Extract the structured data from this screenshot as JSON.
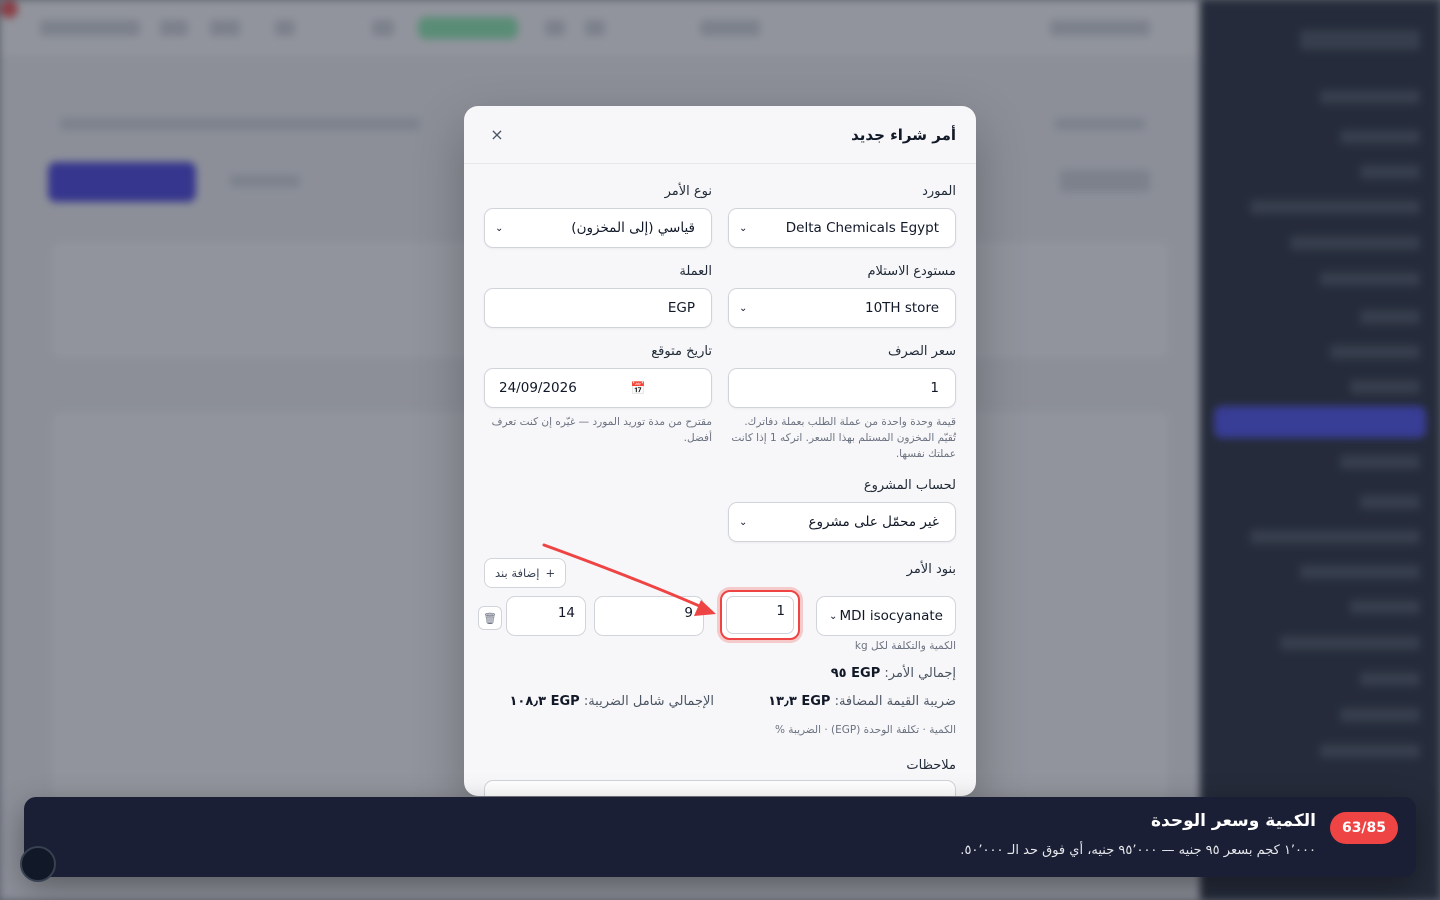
{
  "modal": {
    "title": "أمر شراء جديد",
    "close_icon": "×",
    "supplier": {
      "label": "المورد",
      "value": "Delta Chemicals Egypt"
    },
    "order_type": {
      "label": "نوع الأمر",
      "value": "قياسي (إلى المخزون)"
    },
    "warehouse": {
      "label": "مستودع الاستلام",
      "value": "10TH store"
    },
    "currency": {
      "label": "العملة",
      "value": "EGP"
    },
    "exchange_rate": {
      "label": "سعر الصرف",
      "value": "1",
      "help": "قيمة وحدة واحدة من عملة الطلب بعملة دفاترك. تُقيّم المخزون المستلم بهذا السعر. اتركه 1 إذا كانت عملتك نفسها."
    },
    "expected_date": {
      "label": "تاريخ متوقع",
      "value": "24/09/2026",
      "help": "مقترح من مدة توريد المورد — غيّره إن كنت تعرف أفضل."
    },
    "project": {
      "label": "لحساب المشروع",
      "value": "غير محمّل على مشروع"
    },
    "lines": {
      "label": "بنود الأمر",
      "add_button": "إضافة بند",
      "product": "MDI isocyanate",
      "quantity": "1",
      "unit_cost": "9",
      "tax_percent": "14",
      "hint": "الكمية والتكلفة لكل kg"
    },
    "totals": {
      "order_total_label": "إجمالي الأمر:",
      "order_total_value": "EGP ٩٥",
      "vat_label": "ضريبة القيمة المضافة:",
      "vat_value": "EGP ١٣٫٣",
      "grand_total_label": "الإجمالي شامل الضريبة:",
      "grand_total_value": "EGP ١٠٨٫٣",
      "legend": "الكمية · تكلفة الوحدة (EGP) · الضريبة %"
    },
    "notes": {
      "label": "ملاحظات"
    }
  },
  "tour": {
    "step": "63/85",
    "title": "الكمية وسعر الوحدة",
    "description": "١٬٠٠٠ كجم بسعر ٩٥ جنيه — ٩٥٬٠٠٠ جنيه، أي فوق حد الـ ٥٠٬٠٠٠."
  },
  "colors": {
    "accent": "#ef4444",
    "primary": "#3730e0",
    "banner": "#1a1f35"
  }
}
